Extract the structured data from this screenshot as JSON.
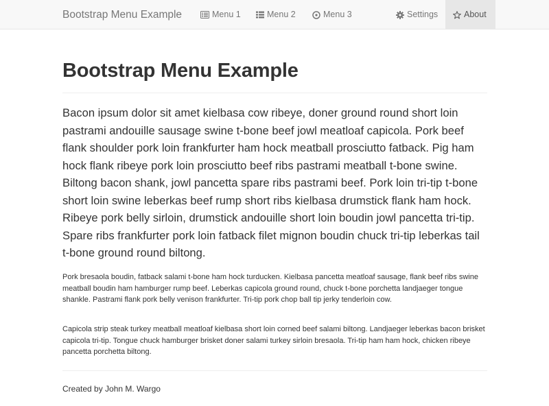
{
  "navbar": {
    "brand": "Bootstrap Menu Example",
    "items": [
      {
        "label": "Menu 1",
        "icon": "list-alt-icon"
      },
      {
        "label": "Menu 2",
        "icon": "list-icon"
      },
      {
        "label": "Menu 3",
        "icon": "clock-icon"
      }
    ],
    "right_items": [
      {
        "label": "Settings",
        "icon": "cog-icon"
      },
      {
        "label": "About",
        "icon": "star-icon",
        "active": true
      }
    ]
  },
  "main": {
    "title": "Bootstrap Menu Example",
    "lead": "Bacon ipsum dolor sit amet kielbasa cow ribeye, doner ground round short loin pastrami andouille sausage swine t-bone beef jowl meatloaf capicola. Pork beef flank shoulder pork loin frankfurter ham hock meatball prosciutto fatback. Pig ham hock flank ribeye pork loin prosciutto beef ribs pastrami meatball t-bone swine. Biltong bacon shank, jowl pancetta spare ribs pastrami beef. Pork loin tri-tip t-bone short loin swine leberkas beef rump short ribs kielbasa drumstick flank ham hock. Ribeye pork belly sirloin, drumstick andouille short loin boudin jowl pancetta tri-tip. Spare ribs frankfurter pork loin fatback filet mignon boudin chuck tri-tip leberkas tail t-bone ground round biltong.",
    "paragraphs": [
      "Pork bresaola boudin, fatback salami t-bone ham hock turducken. Kielbasa pancetta meatloaf sausage, flank beef ribs swine meatball boudin ham hamburger rump beef. Leberkas capicola ground round, chuck t-bone porchetta landjaeger tongue shankle. Pastrami flank pork belly venison frankfurter. Tri-tip pork chop ball tip jerky tenderloin cow.",
      "Capicola strip steak turkey meatball meatloaf kielbasa short loin corned beef salami biltong. Landjaeger leberkas bacon brisket capicola tri-tip. Tongue chuck hamburger brisket doner salami turkey sirloin bresaola. Tri-tip ham ham hock, chicken ribeye pancetta porchetta biltong."
    ]
  },
  "footer": {
    "text": "Created by John M. Wargo"
  },
  "colors": {
    "navbar_bg": "#f8f8f8",
    "nav_text": "#777777",
    "active_bg": "#e7e7e7",
    "body_text": "#333333"
  }
}
